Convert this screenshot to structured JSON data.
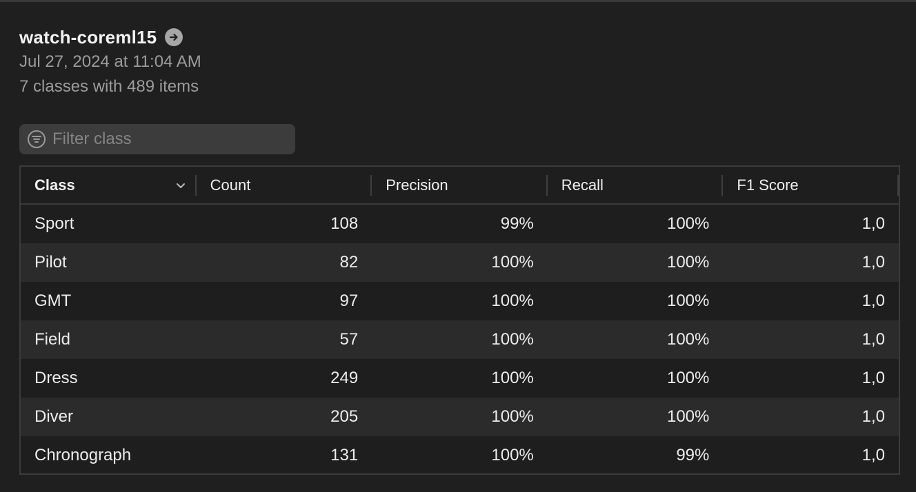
{
  "header": {
    "title": "watch-coreml15",
    "date": "Jul 27, 2024 at 11:04 AM",
    "summary": "7 classes with 489 items"
  },
  "filter": {
    "placeholder": "Filter class",
    "value": ""
  },
  "table": {
    "columns": [
      "Class",
      "Count",
      "Precision",
      "Recall",
      "F1 Score"
    ],
    "sort_column": "Class",
    "rows": [
      {
        "class": "Sport",
        "count": "108",
        "precision": "99%",
        "recall": "100%",
        "f1": "1,0"
      },
      {
        "class": "Pilot",
        "count": "82",
        "precision": "100%",
        "recall": "100%",
        "f1": "1,0"
      },
      {
        "class": "GMT",
        "count": "97",
        "precision": "100%",
        "recall": "100%",
        "f1": "1,0"
      },
      {
        "class": "Field",
        "count": "57",
        "precision": "100%",
        "recall": "100%",
        "f1": "1,0"
      },
      {
        "class": "Dress",
        "count": "249",
        "precision": "100%",
        "recall": "100%",
        "f1": "1,0"
      },
      {
        "class": "Diver",
        "count": "205",
        "precision": "100%",
        "recall": "100%",
        "f1": "1,0"
      },
      {
        "class": "Chronograph",
        "count": "131",
        "precision": "100%",
        "recall": "99%",
        "f1": "1,0"
      }
    ]
  },
  "icons": {
    "title_link": "arrow-right-circle-icon",
    "filter": "filter-lines-icon",
    "sort": "chevron-down-icon"
  },
  "colors": {
    "background": "#1f1f1f",
    "row_alt": "#2b2b2b",
    "filter_field": "#3c3c3c",
    "secondary_text": "#9c9c9c"
  }
}
